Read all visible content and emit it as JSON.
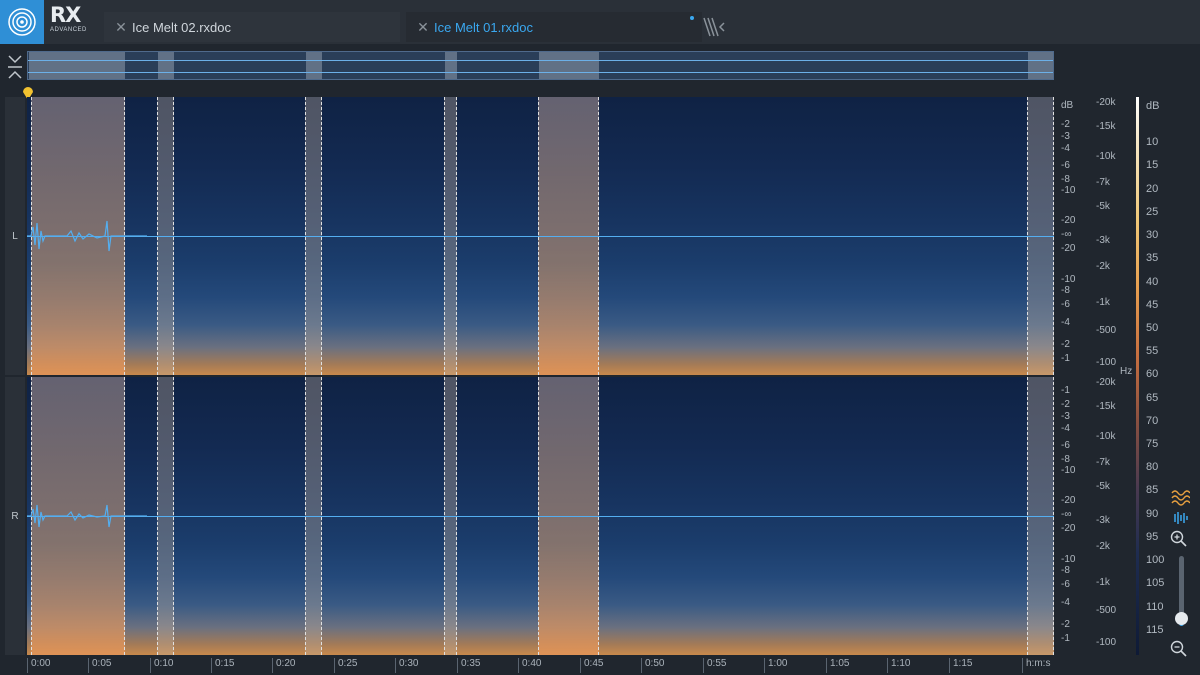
{
  "app": {
    "brand": "RX",
    "edition": "ADVANCED"
  },
  "tabs": [
    {
      "label": "Ice Melt 02.rxdoc",
      "active": false
    },
    {
      "label": "Ice Melt 01.rxdoc",
      "active": true,
      "modified": true
    }
  ],
  "channels": {
    "left": "L",
    "right": "R"
  },
  "db_scale_top": [
    "dB",
    "-2",
    "-3",
    "-4",
    "-6",
    "-8",
    "-10",
    "-20",
    "-∞",
    "-20",
    "-10",
    "-8",
    "-6",
    "-4",
    "-2",
    "-1"
  ],
  "db_scale_bottom": [
    "-1",
    "-2",
    "-3",
    "-4",
    "-6",
    "-8",
    "-10",
    "-20",
    "-∞",
    "-20",
    "-10",
    "-8",
    "-6",
    "-4",
    "-2",
    "-1"
  ],
  "freq_scale_top": [
    "-20k",
    "-15k",
    "-10k",
    "-7k",
    "-5k",
    "-3k",
    "-2k",
    "-1k",
    "-500",
    "-100"
  ],
  "freq_scale_bottom": [
    "-20k",
    "-15k",
    "-10k",
    "-7k",
    "-5k",
    "-3k",
    "-2k",
    "-1k",
    "-500",
    "-100"
  ],
  "hz_unit": "Hz",
  "colorbar": {
    "unit": "dB",
    "values": [
      "10",
      "15",
      "20",
      "25",
      "30",
      "35",
      "40",
      "45",
      "50",
      "55",
      "60",
      "65",
      "70",
      "75",
      "80",
      "85",
      "90",
      "95",
      "100",
      "105",
      "110",
      "115"
    ]
  },
  "timeline": [
    "0:00",
    "0:05",
    "0:10",
    "0:15",
    "0:20",
    "0:25",
    "0:30",
    "0:35",
    "0:40",
    "0:45",
    "0:50",
    "0:55",
    "1:00",
    "1:05",
    "1:10",
    "1:15",
    "h:m:s"
  ],
  "tools": {
    "spectrogram": "spectrogram-icon",
    "waveform": "waveform-icon",
    "zoom_in": "zoom-in-icon",
    "zoom_out": "zoom-out-icon"
  },
  "colors": {
    "accent": "#3aa8f0",
    "waveform": "#54aef0",
    "background": "#20262e"
  }
}
